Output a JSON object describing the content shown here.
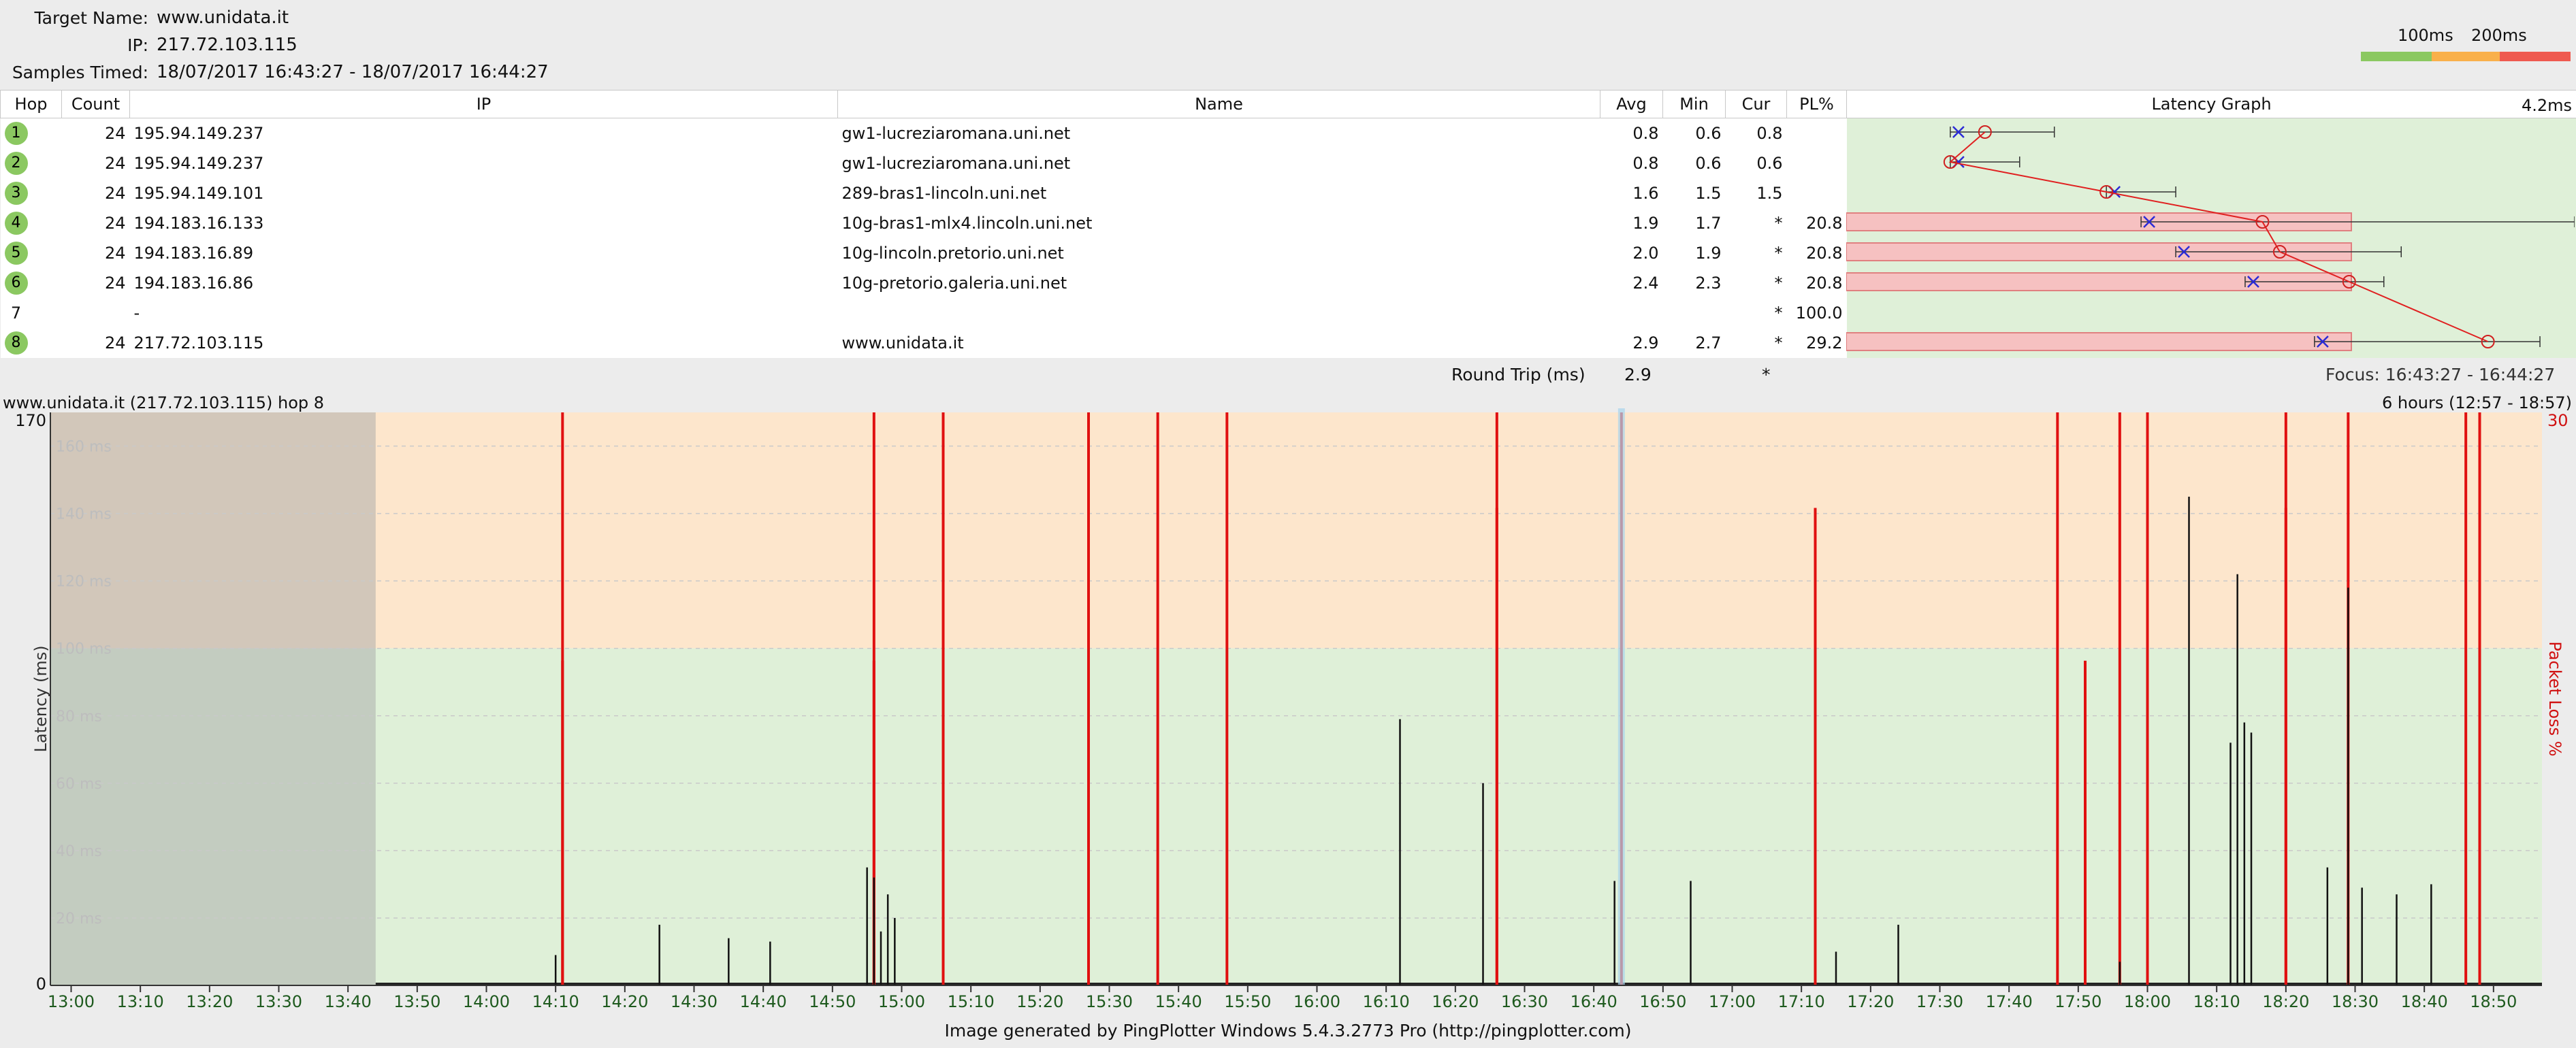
{
  "header": {
    "target_label": "Target Name:",
    "target_value": "www.unidata.it",
    "ip_label": "IP:",
    "ip_value": "217.72.103.115",
    "samples_label": "Samples Timed:",
    "samples_value": "18/07/2017 16:43:27 - 18/07/2017 16:44:27",
    "legend_100": "100ms",
    "legend_200": "200ms"
  },
  "columns": {
    "hop": "Hop",
    "count": "Count",
    "ip": "IP",
    "name": "Name",
    "avg": "Avg",
    "min": "Min",
    "cur": "Cur",
    "pl": "PL%",
    "graph": "Latency Graph",
    "graph_max": "4.2ms"
  },
  "hops": [
    {
      "hop": "1",
      "count": "24",
      "ip": "195.94.149.237",
      "name": "gw1-lucreziaromana.uni.net",
      "avg": "0.8",
      "min": "0.6",
      "cur": "0.8",
      "pl": ""
    },
    {
      "hop": "2",
      "count": "24",
      "ip": "195.94.149.237",
      "name": "gw1-lucreziaromana.uni.net",
      "avg": "0.8",
      "min": "0.6",
      "cur": "0.6",
      "pl": ""
    },
    {
      "hop": "3",
      "count": "24",
      "ip": "195.94.149.101",
      "name": "289-bras1-lincoln.uni.net",
      "avg": "1.6",
      "min": "1.5",
      "cur": "1.5",
      "pl": ""
    },
    {
      "hop": "4",
      "count": "24",
      "ip": "194.183.16.133",
      "name": "10g-bras1-mlx4.lincoln.uni.net",
      "avg": "1.9",
      "min": "1.7",
      "cur": "*",
      "pl": "20.8"
    },
    {
      "hop": "5",
      "count": "24",
      "ip": "194.183.16.89",
      "name": "10g-lincoln.pretorio.uni.net",
      "avg": "2.0",
      "min": "1.9",
      "cur": "*",
      "pl": "20.8"
    },
    {
      "hop": "6",
      "count": "24",
      "ip": "194.183.16.86",
      "name": "10g-pretorio.galeria.uni.net",
      "avg": "2.4",
      "min": "2.3",
      "cur": "*",
      "pl": "20.8"
    },
    {
      "hop": "7",
      "count": "",
      "ip": "-",
      "name": "",
      "avg": "",
      "min": "",
      "cur": "*",
      "pl": "100.0"
    },
    {
      "hop": "8",
      "count": "24",
      "ip": "217.72.103.115",
      "name": "www.unidata.it",
      "avg": "2.9",
      "min": "2.7",
      "cur": "*",
      "pl": "29.2"
    }
  ],
  "round_trip": {
    "label": "Round Trip (ms)",
    "avg": "2.9",
    "cur": "*",
    "focus": "Focus: 16:43:27 - 16:44:27"
  },
  "timeline": {
    "title": "www.unidata.it (217.72.103.115) hop 8",
    "range": "6 hours (12:57 - 18:57)",
    "ylabel": "Latency (ms)",
    "y2label": "Packet Loss %",
    "ymax": "170",
    "ymin": "0",
    "y2max": "30",
    "gridlines": [
      "160 ms",
      "140 ms",
      "120 ms",
      "100 ms",
      "80 ms",
      "60 ms",
      "40 ms",
      "20 ms"
    ],
    "xticks": [
      "13:00",
      "13:10",
      "13:20",
      "13:30",
      "13:40",
      "13:50",
      "14:00",
      "14:10",
      "14:20",
      "14:30",
      "14:40",
      "14:50",
      "15:00",
      "15:10",
      "15:20",
      "15:30",
      "15:40",
      "15:50",
      "16:00",
      "16:10",
      "16:20",
      "16:30",
      "16:40",
      "16:50",
      "17:00",
      "17:10",
      "17:20",
      "17:30",
      "17:40",
      "17:50",
      "18:00",
      "18:10",
      "18:20",
      "18:30",
      "18:40",
      "18:50"
    ]
  },
  "chart_data": {
    "type": "bar",
    "title": "www.unidata.it (217.72.103.115) hop 8",
    "xlabel": "",
    "ylabel": "Latency (ms)",
    "y2label": "Packet Loss %",
    "ylim": [
      0,
      170
    ],
    "y2lim": [
      0,
      30
    ],
    "x_range": [
      "12:57",
      "18:57"
    ],
    "zones": {
      "good_max_ms": 100,
      "warn_color": "#fde6cc",
      "good_color": "#dff0d8",
      "nodata_end": "13:44"
    },
    "latency_spikes": [
      {
        "t": "14:10",
        "ms": 9
      },
      {
        "t": "14:25",
        "ms": 18
      },
      {
        "t": "14:35",
        "ms": 14
      },
      {
        "t": "14:41",
        "ms": 13
      },
      {
        "t": "14:55",
        "ms": 35
      },
      {
        "t": "14:56",
        "ms": 32
      },
      {
        "t": "14:57",
        "ms": 16
      },
      {
        "t": "14:58",
        "ms": 27
      },
      {
        "t": "14:59",
        "ms": 20
      },
      {
        "t": "16:12",
        "ms": 79
      },
      {
        "t": "16:24",
        "ms": 60
      },
      {
        "t": "16:43",
        "ms": 31
      },
      {
        "t": "16:54",
        "ms": 31
      },
      {
        "t": "17:15",
        "ms": 10
      },
      {
        "t": "17:24",
        "ms": 18
      },
      {
        "t": "17:56",
        "ms": 7
      },
      {
        "t": "18:06",
        "ms": 145
      },
      {
        "t": "18:12",
        "ms": 72
      },
      {
        "t": "18:13",
        "ms": 122
      },
      {
        "t": "18:14",
        "ms": 78
      },
      {
        "t": "18:15",
        "ms": 75
      },
      {
        "t": "18:26",
        "ms": 35
      },
      {
        "t": "18:29",
        "ms": 118
      },
      {
        "t": "18:31",
        "ms": 29
      },
      {
        "t": "18:36",
        "ms": 27
      },
      {
        "t": "18:41",
        "ms": 30
      }
    ],
    "loss_events": [
      {
        "t": "14:11",
        "pct": 30
      },
      {
        "t": "14:11",
        "pct": 17
      },
      {
        "t": "14:56",
        "pct": 30
      },
      {
        "t": "14:56",
        "pct": 17
      },
      {
        "t": "15:06",
        "pct": 30
      },
      {
        "t": "15:27",
        "pct": 30
      },
      {
        "t": "15:37",
        "pct": 30
      },
      {
        "t": "15:47",
        "pct": 30
      },
      {
        "t": "16:26",
        "pct": 30
      },
      {
        "t": "16:26",
        "pct": 25
      },
      {
        "t": "16:44",
        "pct": 30
      },
      {
        "t": "17:12",
        "pct": 25
      },
      {
        "t": "17:12",
        "pct": 17
      },
      {
        "t": "17:47",
        "pct": 30
      },
      {
        "t": "17:51",
        "pct": 17
      },
      {
        "t": "17:56",
        "pct": 30
      },
      {
        "t": "18:00",
        "pct": 30
      },
      {
        "t": "18:20",
        "pct": 30
      },
      {
        "t": "18:20",
        "pct": 25
      },
      {
        "t": "18:29",
        "pct": 30
      },
      {
        "t": "18:46",
        "pct": 30
      },
      {
        "t": "18:48",
        "pct": 30
      }
    ]
  },
  "latency_graph": {
    "points_ms": [
      0.8,
      0.6,
      1.5,
      2.4,
      2.5,
      2.9,
      null,
      3.7
    ],
    "min_ms": [
      0.6,
      0.6,
      1.5,
      1.7,
      1.9,
      2.3,
      null,
      2.7
    ],
    "max_ms": [
      1.2,
      1.0,
      1.9,
      4.2,
      3.2,
      3.1,
      null,
      4.0
    ],
    "loss_bar": [
      false,
      false,
      false,
      true,
      true,
      true,
      false,
      true
    ],
    "scale_max_ms": 4.2
  },
  "footer": "Image generated by PingPlotter Windows 5.4.3.2773 Pro (http://pingplotter.com)"
}
